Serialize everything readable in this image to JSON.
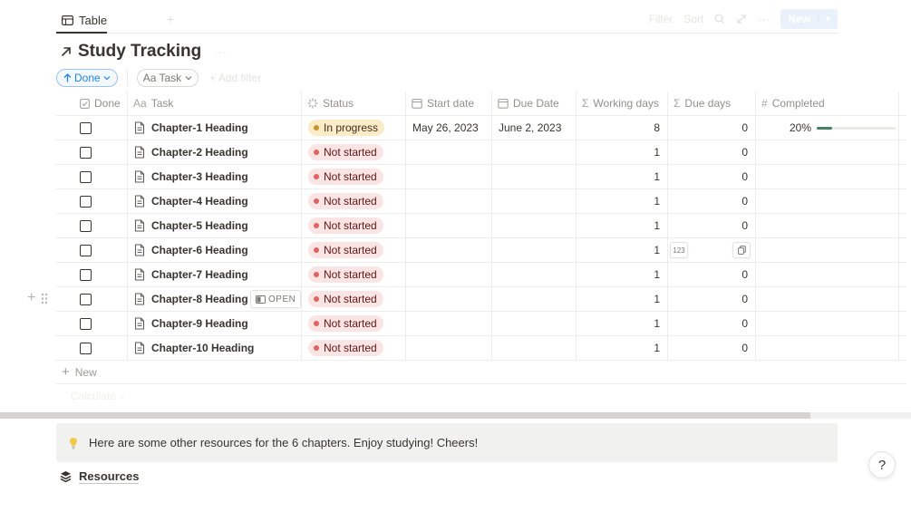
{
  "view": {
    "tab_label": "Table",
    "filter_label": "Filter",
    "sort_label": "Sort",
    "new_label": "New"
  },
  "database": {
    "title": "Study Tracking"
  },
  "filters": {
    "sort_chip": "Done",
    "task_chip": "Aa Task",
    "add_filter": "+ Add filter"
  },
  "columns": {
    "done": "Done",
    "task": "Task",
    "status": "Status",
    "start_date": "Start date",
    "due_date": "Due Date",
    "working_days": "Working days",
    "due_days": "Due days",
    "completed": "Completed"
  },
  "rows": [
    {
      "task": "Chapter-1 Heading",
      "status": "In progress",
      "status_type": "in-progress",
      "start_date": "May 26, 2023",
      "due_date": "June 2, 2023",
      "working_days": "8",
      "due_days": "0",
      "completed_text": "20%",
      "completed_fraction": 0.2
    },
    {
      "task": "Chapter-2 Heading",
      "status": "Not started",
      "status_type": "not-started",
      "start_date": "",
      "due_date": "",
      "working_days": "1",
      "due_days": "0",
      "completed_text": ""
    },
    {
      "task": "Chapter-3 Heading",
      "status": "Not started",
      "status_type": "not-started",
      "start_date": "",
      "due_date": "",
      "working_days": "1",
      "due_days": "0",
      "completed_text": ""
    },
    {
      "task": "Chapter-4 Heading",
      "status": "Not started",
      "status_type": "not-started",
      "start_date": "",
      "due_date": "",
      "working_days": "1",
      "due_days": "0",
      "completed_text": ""
    },
    {
      "task": "Chapter-5 Heading",
      "status": "Not started",
      "status_type": "not-started",
      "start_date": "",
      "due_date": "",
      "working_days": "1",
      "due_days": "0",
      "completed_text": ""
    },
    {
      "task": "Chapter-6 Heading",
      "status": "Not started",
      "status_type": "not-started",
      "start_date": "",
      "due_date": "",
      "working_days": "1",
      "due_days": "",
      "completed_text": ""
    },
    {
      "task": "Chapter-7 Heading",
      "status": "Not started",
      "status_type": "not-started",
      "start_date": "",
      "due_date": "",
      "working_days": "1",
      "due_days": "0",
      "completed_text": ""
    },
    {
      "task": "Chapter-8 Heading",
      "status": "Not started",
      "status_type": "not-started",
      "start_date": "",
      "due_date": "",
      "working_days": "1",
      "due_days": "0",
      "completed_text": ""
    },
    {
      "task": "Chapter-9 Heading",
      "status": "Not started",
      "status_type": "not-started",
      "start_date": "",
      "due_date": "",
      "working_days": "1",
      "due_days": "0",
      "completed_text": ""
    },
    {
      "task": "Chapter-10 Heading",
      "status": "Not started",
      "status_type": "not-started",
      "start_date": "",
      "due_date": "",
      "working_days": "1",
      "due_days": "0",
      "completed_text": ""
    }
  ],
  "open_button_label": "OPEN",
  "number_format_badge": "123",
  "new_row_label": "New",
  "calculate_label": "Calculate",
  "callout": {
    "text": "Here are some other resources for the 6 chapters. Enjoy studying! Cheers!",
    "icon": "lightbulb-icon"
  },
  "resources_label": "Resources",
  "help_label": "?",
  "colors": {
    "accent": "#2383e2",
    "in_progress_bg": "#fbecc8",
    "not_started_bg": "#fbe4e4",
    "progress_bar": "#448361",
    "callout_bg": "#f1f1ef"
  }
}
